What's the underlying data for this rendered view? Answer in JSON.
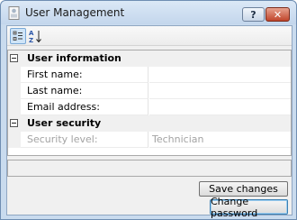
{
  "window": {
    "title": "User Management",
    "help_glyph": "?",
    "close_glyph": "✕"
  },
  "toolbar": {
    "sort_alpha_glyph": "AZ"
  },
  "grid": {
    "categories": [
      {
        "label": "User information",
        "properties": [
          {
            "label": "First name:",
            "value": ""
          },
          {
            "label": "Last name:",
            "value": ""
          },
          {
            "label": "Email address:",
            "value": ""
          }
        ]
      },
      {
        "label": "User security",
        "properties": [
          {
            "label": "Security level:",
            "value": "Technician",
            "disabled": true
          }
        ]
      }
    ]
  },
  "description": "",
  "buttons": {
    "save": "Save changes",
    "change_password": "Change password"
  }
}
